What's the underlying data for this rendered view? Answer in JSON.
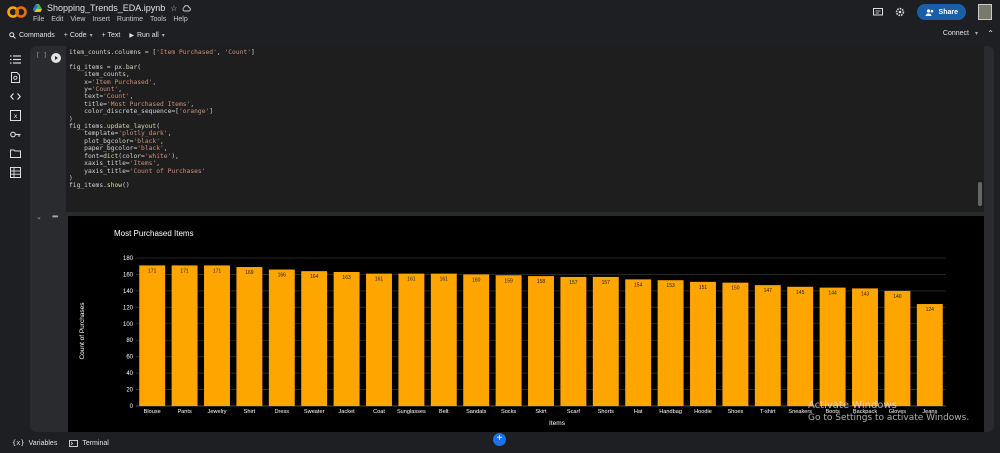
{
  "header": {
    "doc_title": "Shopping_Trends_EDA.ipynb",
    "menu": [
      "File",
      "Edit",
      "View",
      "Insert",
      "Runtime",
      "Tools",
      "Help"
    ],
    "share_label": "Share"
  },
  "toolbar": {
    "commands_label": "Commands",
    "code_label": "+ Code",
    "text_label": "+ Text",
    "run_all_label": "Run all",
    "connect_label": "Connect"
  },
  "cell": {
    "exec_count": "[ ]",
    "code_lines": [
      "item_counts.columns = ['Item Purchased', 'Count']",
      "",
      "fig_items = px.bar(",
      "    item_counts,",
      "    x='Item Purchased',",
      "    y='Count',",
      "    text='Count',",
      "    title='Most Purchased Items',",
      "    color_discrete_sequence=['orange']",
      ")",
      "fig_items.update_layout(",
      "    template='plotly_dark',",
      "    plot_bgcolor='black',",
      "    paper_bgcolor='black',",
      "    font=dict(color='white'),",
      "    xaxis_title='Items',",
      "    yaxis_title='Count of Purchases'",
      ")",
      "fig_items.show()"
    ]
  },
  "chart_data": {
    "type": "bar",
    "title": "Most Purchased Items",
    "xlabel": "Items",
    "ylabel": "Count of Purchases",
    "ylim": [
      0,
      180
    ],
    "yticks": [
      0,
      20,
      40,
      60,
      80,
      100,
      120,
      140,
      160,
      180
    ],
    "color": "#FFA500",
    "grid": true,
    "categories": [
      "Blouse",
      "Pants",
      "Jewelry",
      "Shirt",
      "Dress",
      "Sweater",
      "Jacket",
      "Coat",
      "Sunglasses",
      "Belt",
      "Sandals",
      "Socks",
      "Skirt",
      "Scarf",
      "Shorts",
      "Hat",
      "Handbag",
      "Hoodie",
      "Shoes",
      "T-shirt",
      "Sneakers",
      "Boots",
      "Backpack",
      "Gloves",
      "Jeans"
    ],
    "values": [
      171,
      171,
      171,
      169,
      166,
      164,
      163,
      161,
      161,
      161,
      160,
      159,
      158,
      157,
      157,
      154,
      153,
      151,
      150,
      147,
      145,
      144,
      143,
      140,
      124
    ]
  },
  "statusbar": {
    "variables_label": "Variables",
    "terminal_label": "Terminal"
  },
  "watermark": {
    "title": "Activate Windows",
    "subtitle": "Go to Settings to activate Windows."
  }
}
